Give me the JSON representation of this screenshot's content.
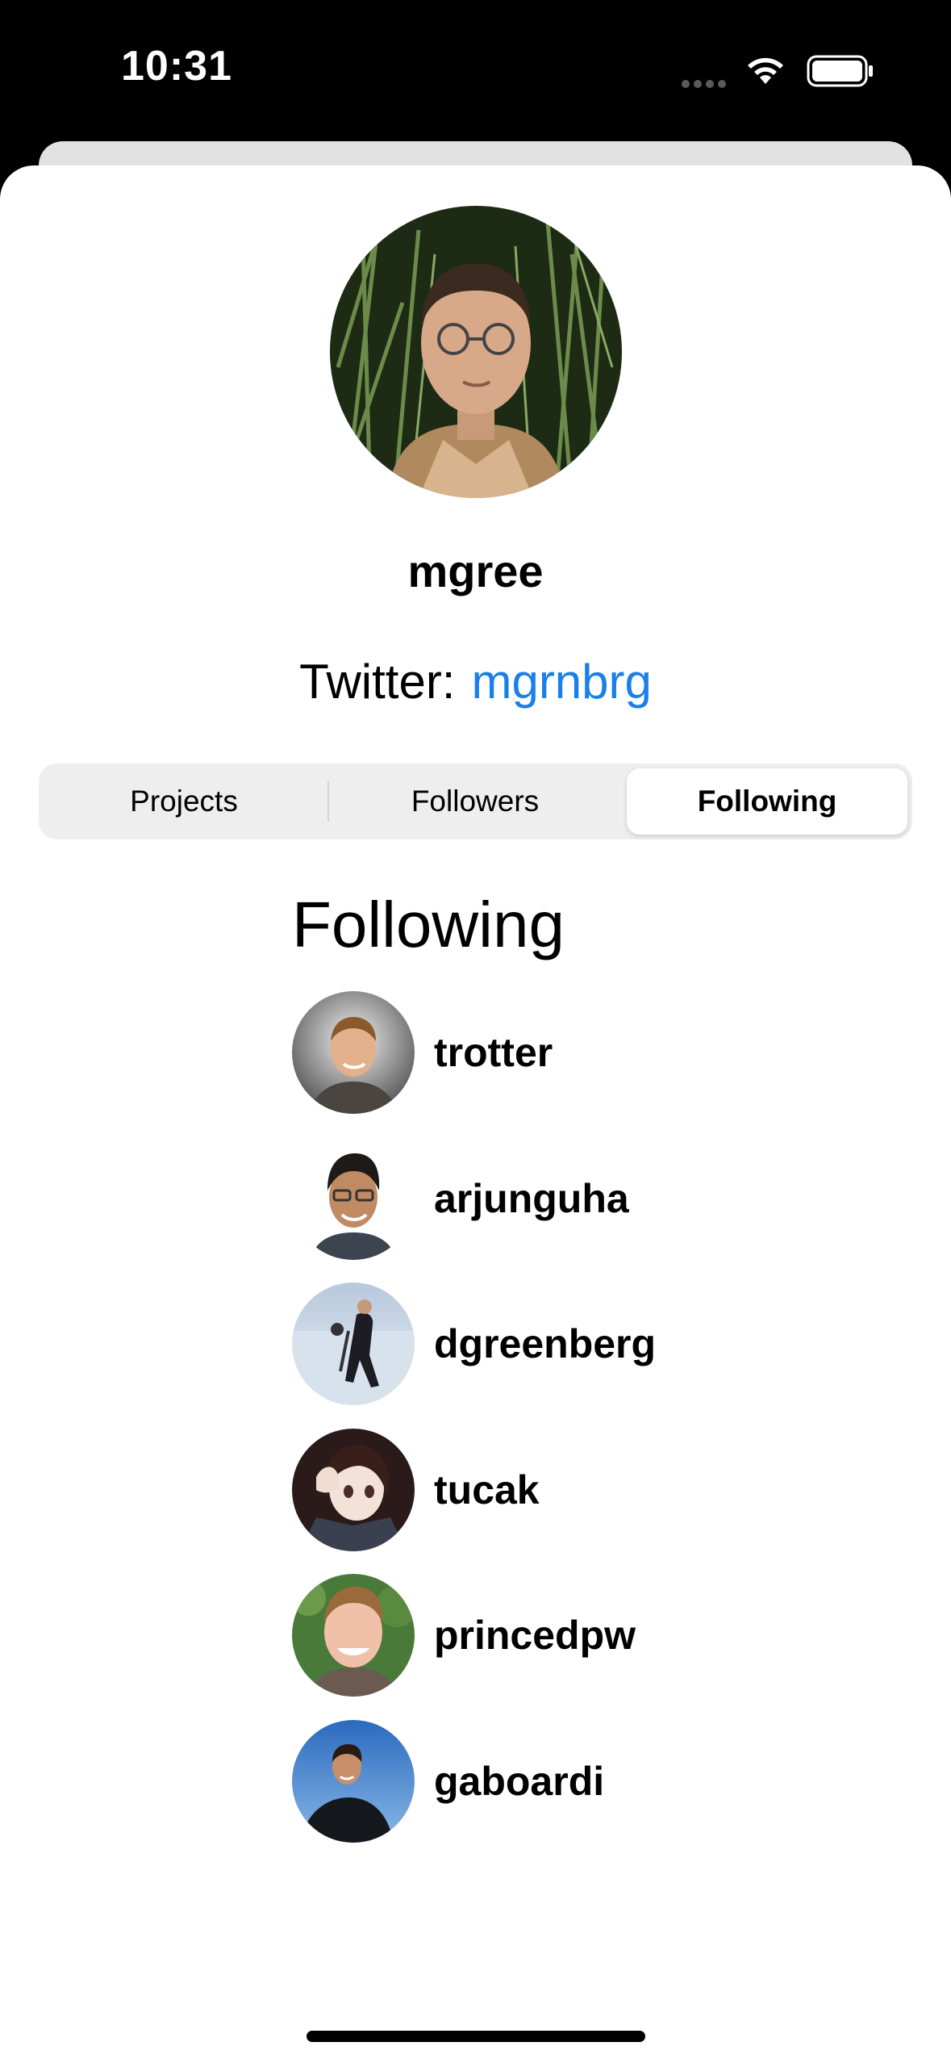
{
  "status_bar": {
    "time": "10:31"
  },
  "profile": {
    "username": "mgree",
    "twitter_label": "Twitter:",
    "twitter_handle": "mgrnbrg"
  },
  "tabs": [
    {
      "label": "Projects",
      "selected": false
    },
    {
      "label": "Followers",
      "selected": false
    },
    {
      "label": "Following",
      "selected": true
    }
  ],
  "following": {
    "title": "Following",
    "users": [
      {
        "name": "trotter"
      },
      {
        "name": "arjunguha"
      },
      {
        "name": "dgreenberg"
      },
      {
        "name": "tucak"
      },
      {
        "name": "princedpw"
      },
      {
        "name": "gaboardi"
      }
    ]
  },
  "colors": {
    "link": "#1a7fe8",
    "segmented_bg": "#eeeeef"
  }
}
